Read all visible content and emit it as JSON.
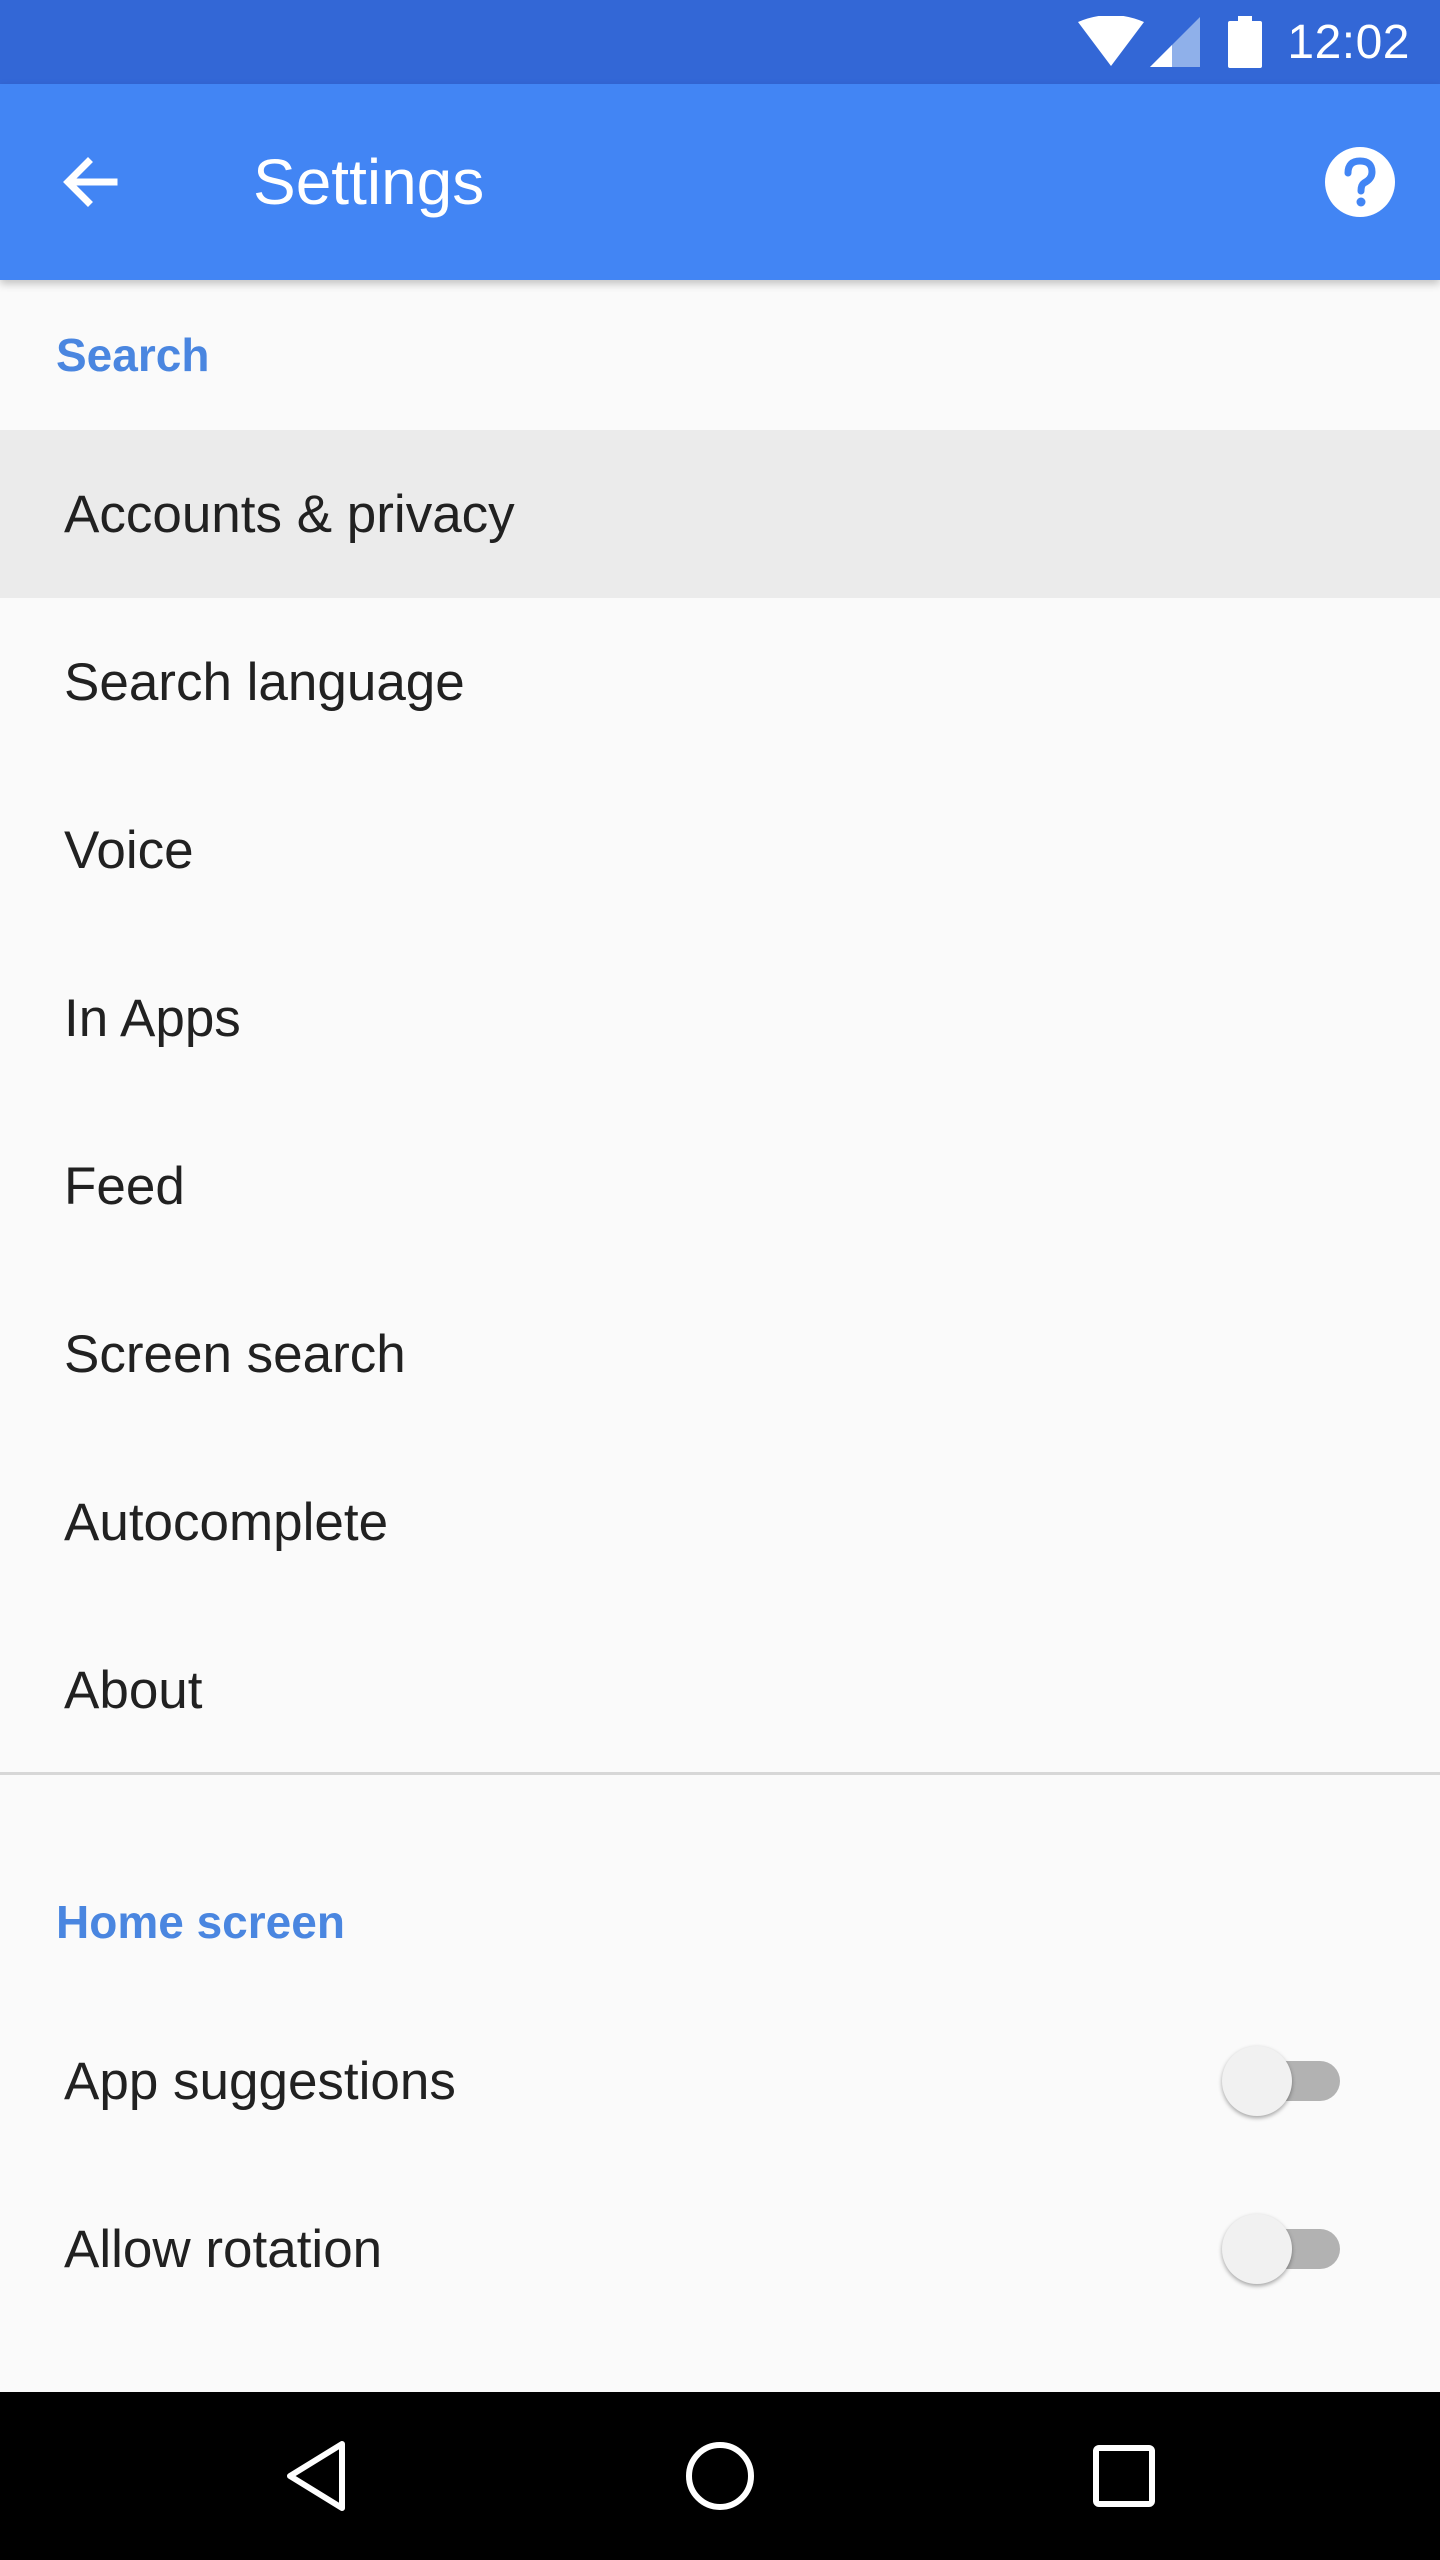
{
  "status_bar": {
    "time": "12:02",
    "icons": [
      "wifi-icon",
      "cell-signal-icon",
      "battery-icon"
    ]
  },
  "app_bar": {
    "title": "Settings",
    "back_icon": "arrow-back-icon",
    "help_icon": "help-circle-icon"
  },
  "sections": {
    "search": {
      "header": "Search",
      "items": [
        {
          "label": "Accounts & privacy"
        },
        {
          "label": "Search language"
        },
        {
          "label": "Voice"
        },
        {
          "label": "In Apps"
        },
        {
          "label": "Feed"
        },
        {
          "label": "Screen search"
        },
        {
          "label": "Autocomplete"
        },
        {
          "label": "About"
        }
      ]
    },
    "home_screen": {
      "header": "Home screen",
      "items": [
        {
          "label": "App suggestions",
          "toggle_on": false
        },
        {
          "label": "Allow rotation",
          "toggle_on": false
        }
      ]
    }
  },
  "nav_bar": {
    "icons": [
      "nav-back-icon",
      "nav-home-icon",
      "nav-recents-icon"
    ]
  },
  "colors": {
    "status_bar": "#3367d6",
    "app_bar": "#4285f4",
    "section_header": "#4a86e0",
    "highlight": "#ebebeb"
  }
}
